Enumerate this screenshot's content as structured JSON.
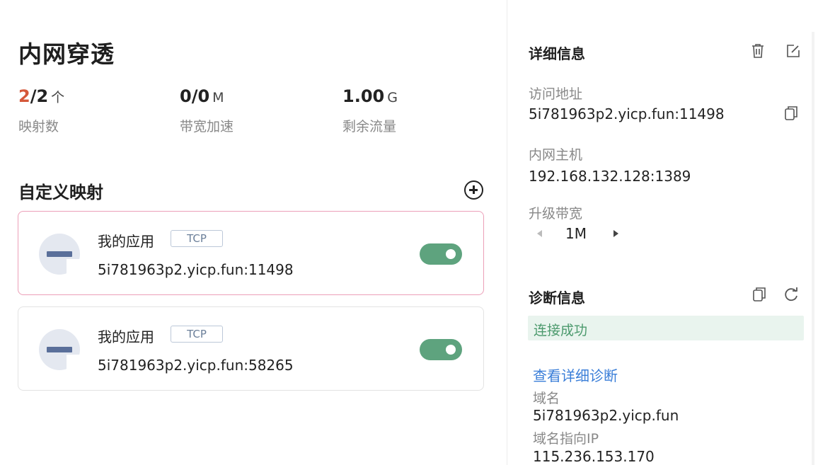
{
  "page": {
    "title": "内网穿透"
  },
  "stats": [
    {
      "highlight": "2",
      "rest": "/2",
      "unit": "个",
      "label": "映射数"
    },
    {
      "highlight": "",
      "rest": "0/0",
      "unit": "M",
      "label": "带宽加速"
    },
    {
      "highlight": "",
      "rest": "1.00",
      "unit": "G",
      "label": "剩余流量"
    }
  ],
  "mappings": {
    "section_title": "自定义映射",
    "items": [
      {
        "name": "我的应用",
        "protocol": "TCP",
        "address": "5i781963p2.yicp.fun:11498",
        "enabled": true,
        "selected": true
      },
      {
        "name": "我的应用",
        "protocol": "TCP",
        "address": "5i781963p2.yicp.fun:58265",
        "enabled": true,
        "selected": false
      }
    ]
  },
  "detail": {
    "title": "详细信息",
    "access_label": "访问地址",
    "access_value": "5i781963p2.yicp.fun:11498",
    "host_label": "内网主机",
    "host_value": "192.168.132.128:1389",
    "bandwidth_label": "升级带宽",
    "bandwidth_value": "1M"
  },
  "diagnosis": {
    "title": "诊断信息",
    "status": "连接成功",
    "link": "查看详细诊断",
    "domain_label": "域名",
    "domain_value": "5i781963p2.yicp.fun",
    "ip_label": "域名指向IP",
    "ip_value": "115.236.153.170"
  },
  "colors": {
    "accent_red": "#d5583a",
    "toggle_green": "#5ea37e",
    "success_text": "#4c9a6d",
    "success_bg": "#e9f4ee",
    "link_blue": "#3a7ed8",
    "selected_border": "#ec9fb8"
  },
  "icons": [
    "add-circle-icon",
    "app-logo-icon",
    "delete-icon",
    "edit-icon",
    "copy-icon",
    "refresh-icon",
    "arrow-left-icon",
    "arrow-right-icon"
  ]
}
